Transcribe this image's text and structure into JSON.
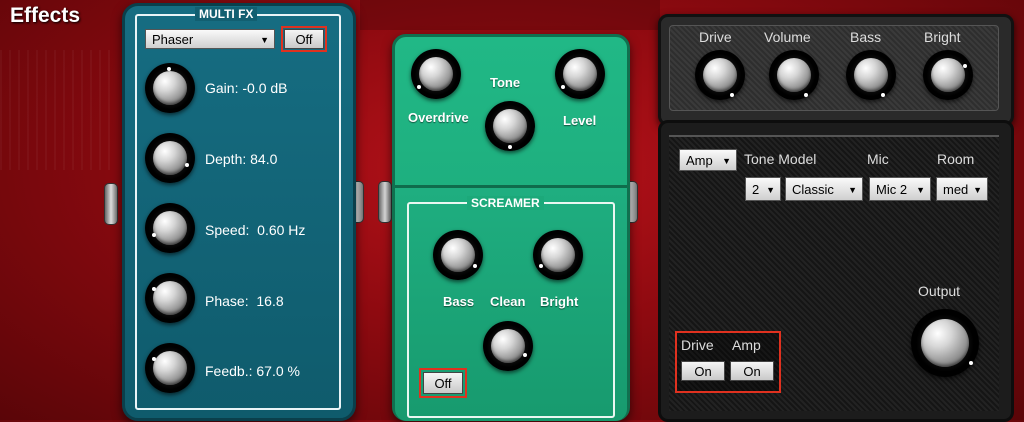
{
  "title": "Effects",
  "multi_fx": {
    "label": "MULTI FX",
    "effect_select": "Phaser",
    "off_button": "Off",
    "params": [
      {
        "label": "Gain:",
        "value": "-0.0 dB"
      },
      {
        "label": "Depth:",
        "value": "84.0"
      },
      {
        "label": "Speed:",
        "value": "0.60 Hz"
      },
      {
        "label": "Phase:",
        "value": "16.8"
      },
      {
        "label": "Feedb.:",
        "value": "67.0 %"
      }
    ]
  },
  "screamer": {
    "label": "SCREAMER",
    "overdrive": "Overdrive",
    "tone": "Tone",
    "level": "Level",
    "bass": "Bass",
    "clean": "Clean",
    "bright": "Bright",
    "off_button": "Off"
  },
  "amp": {
    "top_knobs": [
      "Drive",
      "Volume",
      "Bass",
      "Bright"
    ],
    "amp_select": "Amp",
    "tone_model_label": "Tone Model",
    "mic_label": "Mic",
    "room_label": "Room",
    "number_select": "2",
    "model_select": "Classic",
    "mic_select": "Mic 2",
    "room_select": "med",
    "output_label": "Output",
    "drive_label": "Drive",
    "amp_label": "Amp",
    "drive_button": "On",
    "amp_button": "On"
  },
  "colors": {
    "background": "#9a0b12",
    "multi_fx": "#166d82",
    "screamer": "#21b886",
    "highlight": "#e0311f"
  }
}
